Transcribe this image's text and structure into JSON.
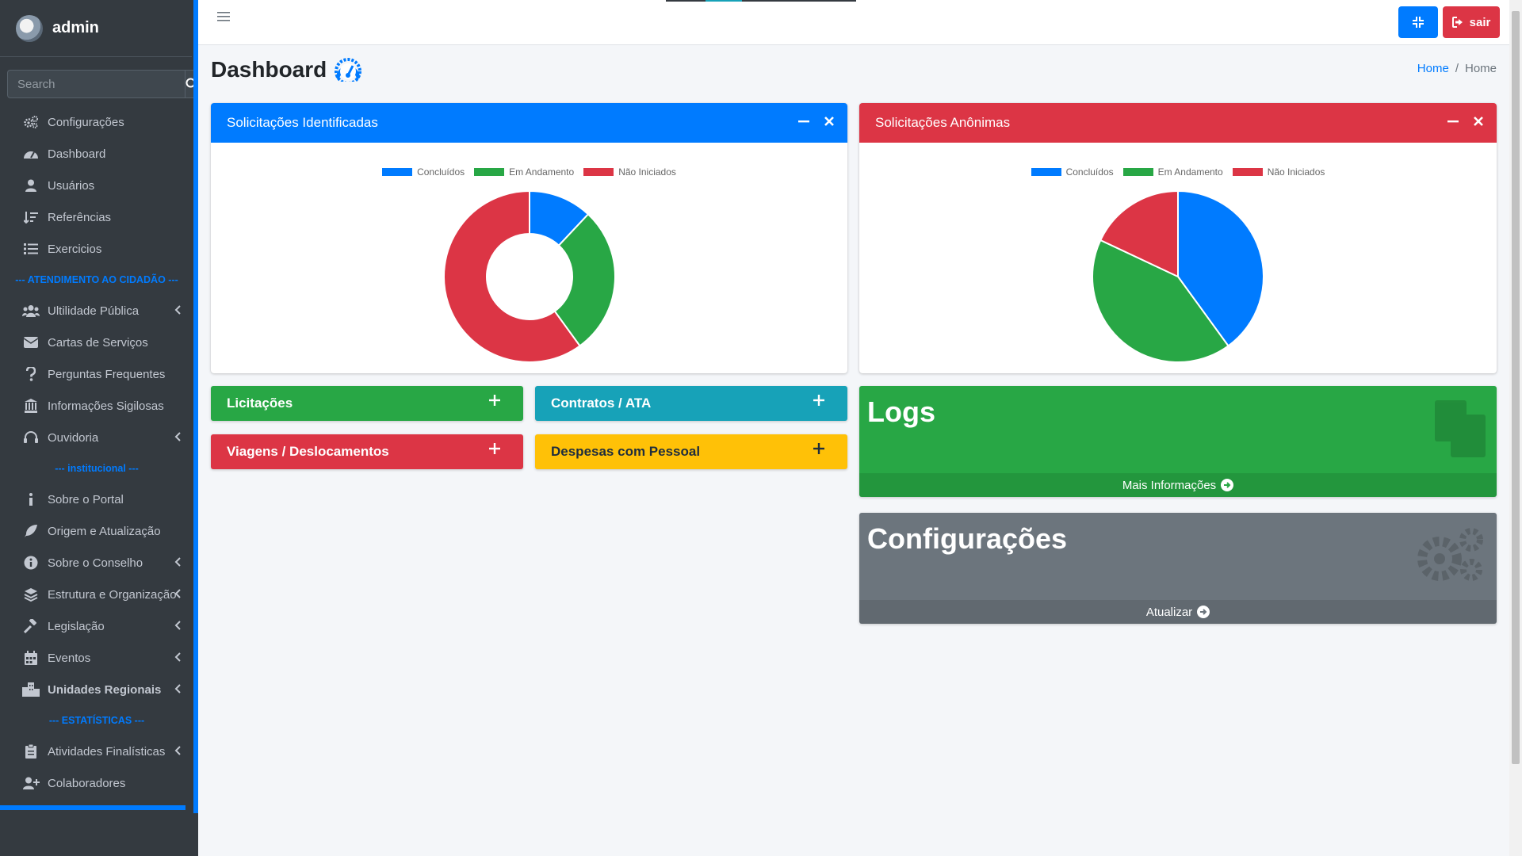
{
  "brand": {
    "name": "admin"
  },
  "search": {
    "placeholder": "Search"
  },
  "sidebar": {
    "items": [
      {
        "label": "Configurações",
        "icon": "cogs-icon"
      },
      {
        "label": "Dashboard",
        "icon": "tachometer-icon"
      },
      {
        "label": "Usuários",
        "icon": "user-icon"
      },
      {
        "label": "Referências",
        "icon": "sort-icon"
      },
      {
        "label": "Exercicios",
        "icon": "list-icon"
      }
    ],
    "header_atendimento": "--- ATENDIMENTO AO CIDADÃO ---",
    "atendimento": [
      {
        "label": "Ultilidade Pública",
        "icon": "users-icon",
        "chevron": true
      },
      {
        "label": "Cartas de Serviços",
        "icon": "envelope-icon"
      },
      {
        "label": "Perguntas Frequentes",
        "icon": "question-icon"
      },
      {
        "label": "Informações Sigilosas",
        "icon": "building-icon"
      },
      {
        "label": "Ouvidoria",
        "icon": "headset-icon",
        "chevron": true
      }
    ],
    "header_institucional": "--- institucional ---",
    "institucional": [
      {
        "label": "Sobre o Portal",
        "icon": "info-icon"
      },
      {
        "label": "Origem e Atualização",
        "icon": "feather-icon"
      },
      {
        "label": "Sobre o Conselho",
        "icon": "info-circle-icon",
        "chevron": true
      },
      {
        "label": "Estrutura e Organização",
        "icon": "layers-icon",
        "chevron": true
      },
      {
        "label": "Legislação",
        "icon": "gavel-icon",
        "chevron": true
      },
      {
        "label": "Eventos",
        "icon": "calendar-icon",
        "chevron": true
      },
      {
        "label": "Unidades Regionais",
        "icon": "city-icon",
        "chevron": true,
        "bold": true
      }
    ],
    "header_estatisticas": "--- ESTATÍSTICAS ---",
    "estatisticas": [
      {
        "label": "Atividades Finalísticas",
        "icon": "clipboard-icon",
        "chevron": true
      },
      {
        "label": "Colaboradores",
        "icon": "user-plus-icon"
      }
    ]
  },
  "topbar": {
    "logout_label": "sair"
  },
  "page": {
    "title": "Dashboard"
  },
  "breadcrumb": {
    "home": "Home",
    "current": "Home"
  },
  "cards": {
    "identificadas": {
      "title": "Solicitações Identificadas",
      "color": "#007bff"
    },
    "anonimas": {
      "title": "Solicitações Anônimas",
      "color": "#dc3545"
    }
  },
  "legend": {
    "concluidos": "Concluídos",
    "andamento": "Em Andamento",
    "nao_iniciados": "Não Iniciados"
  },
  "colors": {
    "blue": "#007bff",
    "green": "#28a745",
    "red": "#dc3545",
    "yellow": "#ffc107",
    "teal": "#17a2b8",
    "gray": "#6c757d"
  },
  "chart_data": [
    {
      "type": "pie",
      "variant": "doughnut",
      "categories": [
        "Concluídos",
        "Em Andamento",
        "Não Iniciados"
      ],
      "values": [
        12,
        28,
        60
      ],
      "colors": [
        "#007bff",
        "#28a745",
        "#dc3545"
      ],
      "legend": "top"
    },
    {
      "type": "pie",
      "categories": [
        "Concluídos",
        "Em Andamento",
        "Não Iniciados"
      ],
      "values": [
        40,
        42,
        18
      ],
      "colors": [
        "#007bff",
        "#28a745",
        "#dc3545"
      ],
      "legend": "top"
    }
  ],
  "tiles": {
    "licitacoes": "Licitações",
    "contratos": "Contratos / ATA",
    "viagens": "Viagens / Deslocamentos",
    "despesas": "Despesas com Pessoal"
  },
  "logs": {
    "title": "Logs",
    "link": "Mais Informações"
  },
  "config_box": {
    "title": "Configurações",
    "link": "Atualizar"
  }
}
